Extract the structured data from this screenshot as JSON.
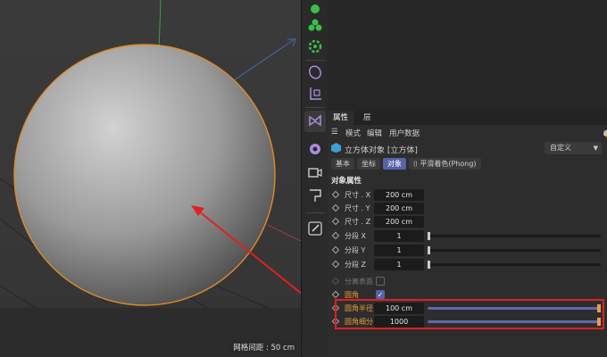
{
  "viewport": {
    "grid_spacing": "网格间距 : 50 cm"
  },
  "tabs": [
    "属性",
    "层"
  ],
  "menu": {
    "mode": "模式",
    "edit": "编辑",
    "user_data": "用户数据"
  },
  "object": {
    "title": "立方体对象 [立方体]",
    "preset": "自定义"
  },
  "subtabs": [
    "基本",
    "坐标",
    "对象",
    "平滑着色(Phong)"
  ],
  "section_title": "对象属性",
  "rows": [
    {
      "label": "尺寸 . X",
      "value": "200 cm"
    },
    {
      "label": "尺寸 . Y",
      "value": "200 cm"
    },
    {
      "label": "尺寸 . Z",
      "value": "200 cm"
    },
    {
      "label": "分段 X",
      "value": "1",
      "slider_fraction": 0.0
    },
    {
      "label": "分段 Y",
      "value": "1",
      "slider_fraction": 0.0
    },
    {
      "label": "分段 Z",
      "value": "1",
      "slider_fraction": 0.0
    },
    {
      "label": "分离表面",
      "checked": false
    },
    {
      "label": "圆角",
      "checked": true
    },
    {
      "label": "圆角半径",
      "value": "100 cm",
      "slider_fraction": 1.0
    },
    {
      "label": "圆角细分",
      "value": "1000",
      "slider_fraction": 1.0
    }
  ],
  "colors": {
    "accent": "#5563a8",
    "highlight_box": "#e02020",
    "selection": "#e08a2a"
  },
  "icons": [
    "sphere-primitive-icon",
    "cloner-icon",
    "mograph-icon",
    "capsule-icon",
    "transform-icon",
    "spline-icon",
    "deformer-icon",
    "camera-icon",
    "tag-icon",
    "edit-icon"
  ]
}
